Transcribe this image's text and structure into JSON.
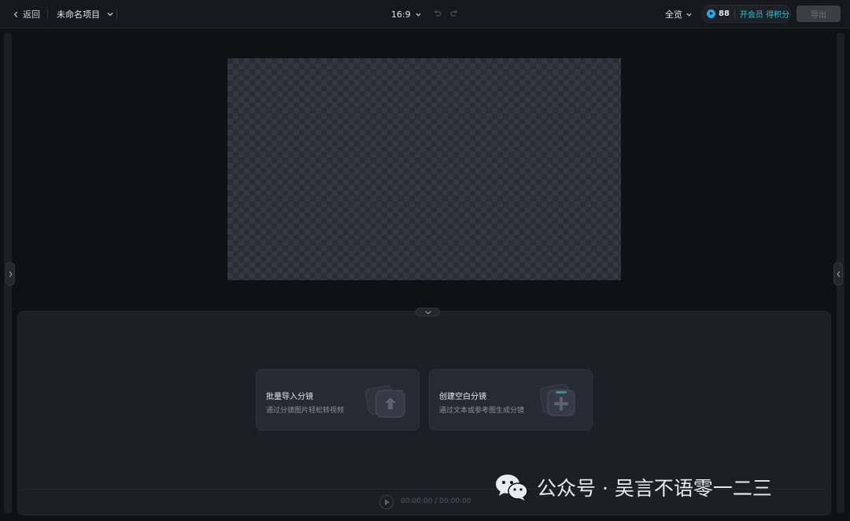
{
  "topbar": {
    "back_label": "返回",
    "project_name": "未命名项目",
    "aspect_ratio": "16:9",
    "preview_label": "全览",
    "credits": "88",
    "vip_label": "开会员 得积分",
    "export_label": "导出"
  },
  "storyboard": {
    "cards": [
      {
        "title": "批量导入分镜",
        "subtitle": "通过分镜图片轻松转视频"
      },
      {
        "title": "创建空白分镜",
        "subtitle": "通过文本或参考图生成分镜"
      }
    ]
  },
  "timeline": {
    "timecode": "00:00:00 / 00:00:00"
  },
  "watermark": {
    "text": "公众号 · 吴言不语零一二三"
  },
  "colors": {
    "background": "#0f1115",
    "panel": "#1c1f26",
    "accent": "#2fc4d8",
    "credit_icon": "#2aa7e0"
  }
}
